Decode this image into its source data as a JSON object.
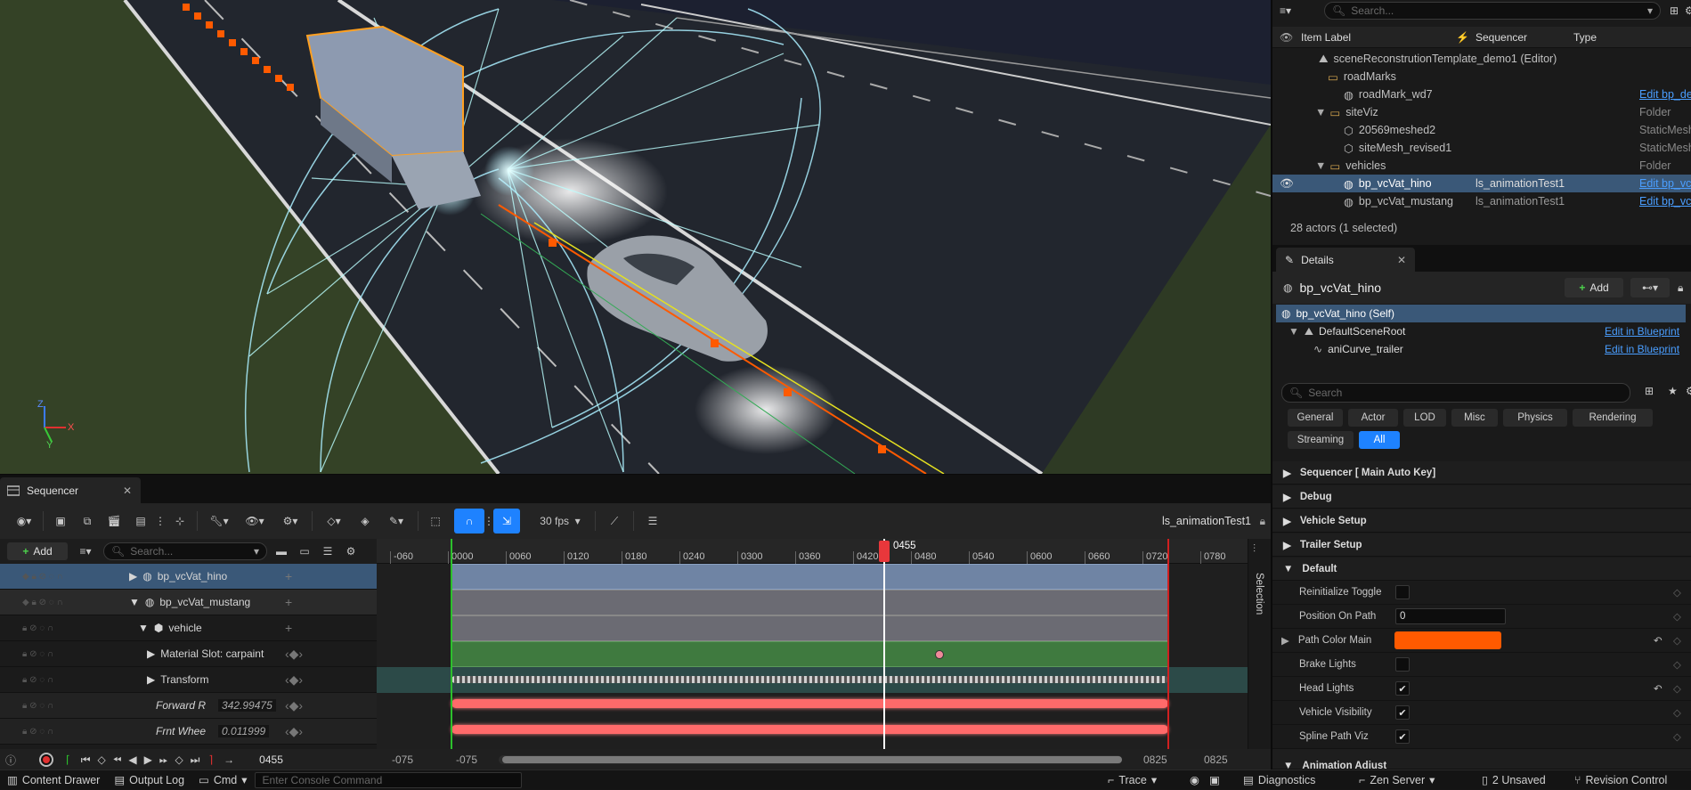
{
  "viewport": {
    "axis_labels": {
      "z": "Z",
      "y": "Y",
      "x": "X"
    }
  },
  "sequencer": {
    "tab_title": "Sequencer",
    "fps": "30 fps",
    "sequence_name": "ls_animationTest1",
    "add_label": "Add",
    "search_placeholder": "Search...",
    "current_frame_marker": "0455",
    "selection_label": "Selection",
    "ruler_ticks": [
      "-060",
      "0000",
      "0060",
      "0120",
      "0180",
      "0240",
      "0300",
      "0360",
      "0420",
      "0480",
      "0540",
      "0600",
      "0660",
      "0720",
      "0780"
    ],
    "tracks": [
      {
        "label": "bp_vcVat_hino",
        "value": "",
        "italic": false
      },
      {
        "label": "bp_vcVat_mustang",
        "value": "",
        "italic": false
      },
      {
        "label": "vehicle",
        "value": "",
        "italic": false
      },
      {
        "label": "Material Slot: carpaint",
        "value": "",
        "italic": false
      },
      {
        "label": "Transform",
        "value": "",
        "italic": false
      },
      {
        "label": "Forward R",
        "value": "342.99475",
        "italic": true
      },
      {
        "label": "Frnt Whee",
        "value": "0.011999",
        "italic": true
      }
    ],
    "transport": {
      "current_frame": "0455",
      "view_start": "-075",
      "view_start_2": "-075",
      "view_end": "0825",
      "view_end_2": "0825"
    }
  },
  "outliner": {
    "search_placeholder": "Search...",
    "columns": {
      "item_label": "Item Label",
      "sequencer": "Sequencer",
      "type": "Type"
    },
    "rows": [
      {
        "label": "sceneReconstrutionTemplate_demo1 (Editor)",
        "sequencer": "",
        "type": ""
      },
      {
        "label": "roadMarks",
        "sequencer": "",
        "type": ""
      },
      {
        "label": "roadMark_wd7",
        "sequencer": "",
        "type": "Edit bp_de"
      },
      {
        "label": "siteViz",
        "sequencer": "",
        "type": "Folder"
      },
      {
        "label": "20569meshed2",
        "sequencer": "",
        "type": "StaticMesh"
      },
      {
        "label": "siteMesh_revised1",
        "sequencer": "",
        "type": "StaticMesh"
      },
      {
        "label": "vehicles",
        "sequencer": "",
        "type": "Folder"
      },
      {
        "label": "bp_vcVat_hino",
        "sequencer": "ls_animationTest1",
        "type": "Edit bp_vc"
      },
      {
        "label": "bp_vcVat_mustang",
        "sequencer": "ls_animationTest1",
        "type": "Edit bp_vc"
      }
    ],
    "footer": "28 actors (1 selected)"
  },
  "details": {
    "tab_title": "Details",
    "actor_name": "bp_vcVat_hino",
    "add_label": "Add",
    "components": [
      {
        "label": "bp_vcVat_hino (Self)",
        "link": ""
      },
      {
        "label": "DefaultSceneRoot",
        "link": "Edit in Blueprint"
      },
      {
        "label": "aniCurve_trailer",
        "link": "Edit in Blueprint"
      }
    ],
    "search_placeholder": "Search",
    "filters": [
      "General",
      "Actor",
      "LOD",
      "Misc",
      "Physics",
      "Rendering",
      "Streaming",
      "All"
    ],
    "categories": [
      "Sequencer [ Main Auto Key]",
      "Debug",
      "Vehicle Setup",
      "Trailer Setup",
      "Default"
    ],
    "properties": [
      {
        "label": "Reinitialize Toggle",
        "kind": "check",
        "value": false
      },
      {
        "label": "Position On Path",
        "kind": "text",
        "value": "0"
      },
      {
        "label": "Path Color Main",
        "kind": "color",
        "value": "#ff5a00"
      },
      {
        "label": "Brake Lights",
        "kind": "check",
        "value": false
      },
      {
        "label": "Head Lights",
        "kind": "check",
        "value": true
      },
      {
        "label": "Vehicle Visibility",
        "kind": "check",
        "value": true
      },
      {
        "label": "Spline Path Viz",
        "kind": "check",
        "value": true
      }
    ],
    "cut_category": "Animation Adjust"
  },
  "statusbar": {
    "content_drawer": "Content Drawer",
    "output_log": "Output Log",
    "cmd": "Cmd",
    "console_placeholder": "Enter Console Command",
    "trace": "Trace",
    "diagnostics": "Diagnostics",
    "zen_server": "Zen Server",
    "unsaved": "2 Unsaved",
    "revision_control": "Revision Control"
  },
  "colors": {
    "accent": "#1e82ff",
    "selection": "#3a5878",
    "path_orange": "#ff5a00",
    "playhead_red": "#e8373b"
  }
}
